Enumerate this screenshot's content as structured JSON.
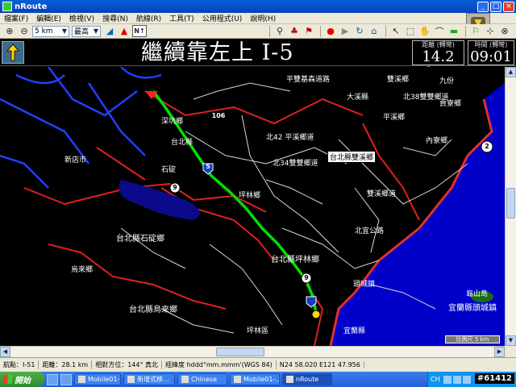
{
  "window": {
    "title": "nRoute"
  },
  "menubar": {
    "items": [
      "檔案(F)",
      "編輯(E)",
      "檢視(V)",
      "搜尋(N)",
      "航線(R)",
      "工具(T)",
      "公用程式(U)",
      "說明(H)"
    ]
  },
  "toolbar": {
    "zoom_value": "5 km",
    "detail_value": "最高",
    "north_label": "N↑"
  },
  "guidance": {
    "instruction": "繼續靠左上 I-5",
    "distance_label": "距離 (轉彎)",
    "distance_value": "14.2 km",
    "time_label": "時間 (轉彎)",
    "time_value": "09:01"
  },
  "map": {
    "labels": [
      "平雙基森道路",
      "大溪縣",
      "雙溪鄉",
      "北38雙雙鄉道",
      "貢寮鄉",
      "九份",
      "深坑鄉",
      "台北縣",
      "台北縣雙溪鄉",
      "內寮鄉",
      "北34雙雙鄉道",
      "石碇",
      "坪林鄉",
      "台北縣石碇鄉",
      "台北縣坪林鄉",
      "北宜公路",
      "頭城鎮",
      "台北縣烏來鄉",
      "烏來鄉",
      "宜蘭縣頭城鎮",
      "龜山島",
      "坪林區",
      "宜蘭縣",
      "新店市",
      "平溪鄉",
      "雙溪鄉道",
      "北42 平溪鄉道"
    ],
    "route_shields": [
      "5",
      "9",
      "2",
      "106",
      "9"
    ],
    "scale_text": "比例尺 5 km"
  },
  "statusbar": {
    "road": "航點：I-51",
    "distance": "距離：28.1 km",
    "bearing": "相對方位：144° 真北",
    "coord_format": "經緯度 hddd°mm.mmm'(WGS 84)",
    "coords": "N24 58.020 E121 47.956"
  },
  "taskbar": {
    "start_label": "開始",
    "tasks": [
      "Mobile01-…",
      "新增式移…",
      "Chinese",
      "Mobile01-…",
      "nRoute"
    ],
    "tray_lang": "CH",
    "watermark": "#61412"
  },
  "colors": {
    "route": "#00e000",
    "road_red": "#e02020",
    "road_blue": "#2040ff",
    "sea": "#0000c8",
    "titlebar": "#0a5fd8"
  }
}
